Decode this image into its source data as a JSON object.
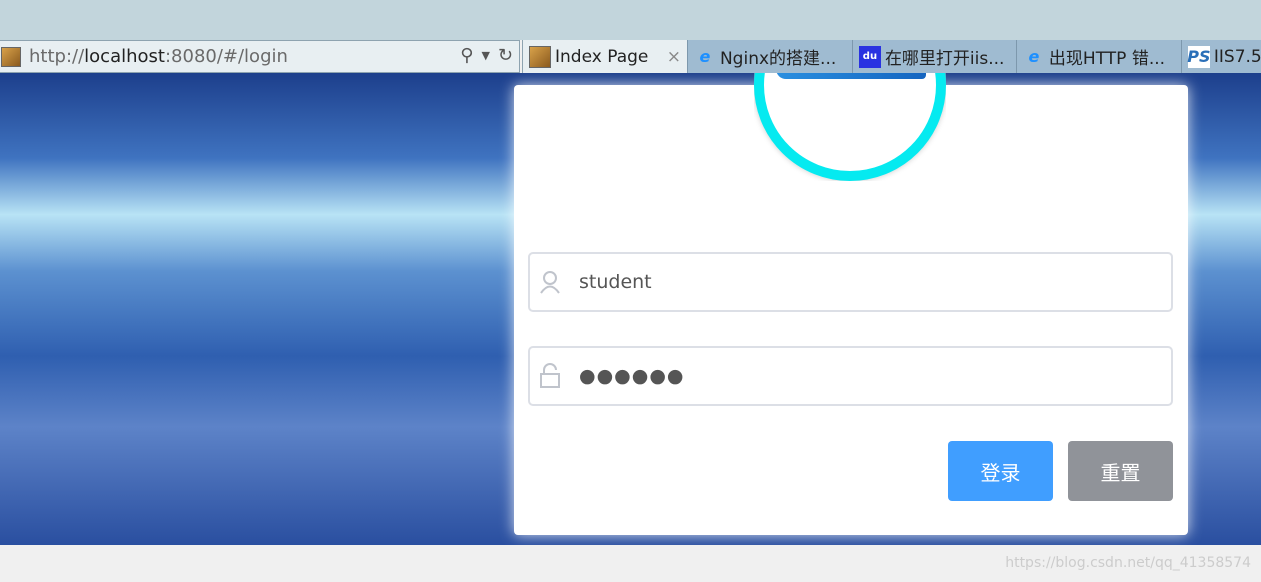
{
  "browser": {
    "url_prefix": "http://",
    "url_host": "localhost",
    "url_rest": ":8080/#/login",
    "tabs": [
      {
        "label": "Index Page",
        "icon": "tomcat-icon",
        "active": true,
        "close": "×"
      },
      {
        "label": "Nginx的搭建...",
        "icon": "ie-icon"
      },
      {
        "label": "在哪里打开iis...",
        "icon": "baidu-icon"
      },
      {
        "label": "出现HTTP 错...",
        "icon": "ie-icon"
      },
      {
        "label": "IIS7.5",
        "icon": "ps-icon"
      }
    ]
  },
  "login": {
    "username": "student",
    "password": "●●●●●●",
    "login_label": "登录",
    "reset_label": "重置",
    "primary_color": "#409eff",
    "logo_ring_color": "#05eaf0"
  },
  "watermark": "https://blog.csdn.net/qq_41358574"
}
